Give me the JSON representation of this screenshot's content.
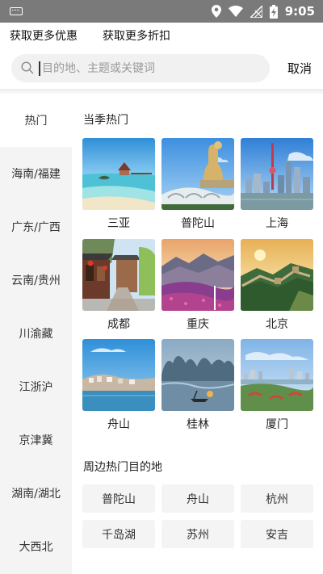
{
  "status_bar": {
    "time": "9:05"
  },
  "promos": {
    "more_deals": "获取更多优惠",
    "more_discounts": "获取更多折扣"
  },
  "search": {
    "placeholder": "目的地、主题或关键词",
    "cancel_label": "取消"
  },
  "sidebar": {
    "items": [
      {
        "label": "热门",
        "active": true
      },
      {
        "label": "海南/福建"
      },
      {
        "label": "广东/广西"
      },
      {
        "label": "云南/贵州"
      },
      {
        "label": "川渝藏"
      },
      {
        "label": "江浙沪"
      },
      {
        "label": "京津冀"
      },
      {
        "label": "湖南/湖北"
      },
      {
        "label": "大西北"
      }
    ]
  },
  "main": {
    "season_title": "当季热门",
    "destinations": [
      {
        "name": "三亚",
        "icon": "beach-photo"
      },
      {
        "name": "普陀山",
        "icon": "statue-photo"
      },
      {
        "name": "上海",
        "icon": "skyline-photo"
      },
      {
        "name": "成都",
        "icon": "old-street-photo"
      },
      {
        "name": "重庆",
        "icon": "mountain-flowers-photo"
      },
      {
        "name": "北京",
        "icon": "great-wall-photo"
      },
      {
        "name": "舟山",
        "icon": "island-town-photo"
      },
      {
        "name": "桂林",
        "icon": "karst-river-photo"
      },
      {
        "name": "厦门",
        "icon": "coastal-city-photo"
      }
    ],
    "nearby_title": "周边热门目的地",
    "nearby": [
      "普陀山",
      "舟山",
      "杭州",
      "千岛湖",
      "苏州",
      "安吉"
    ]
  }
}
